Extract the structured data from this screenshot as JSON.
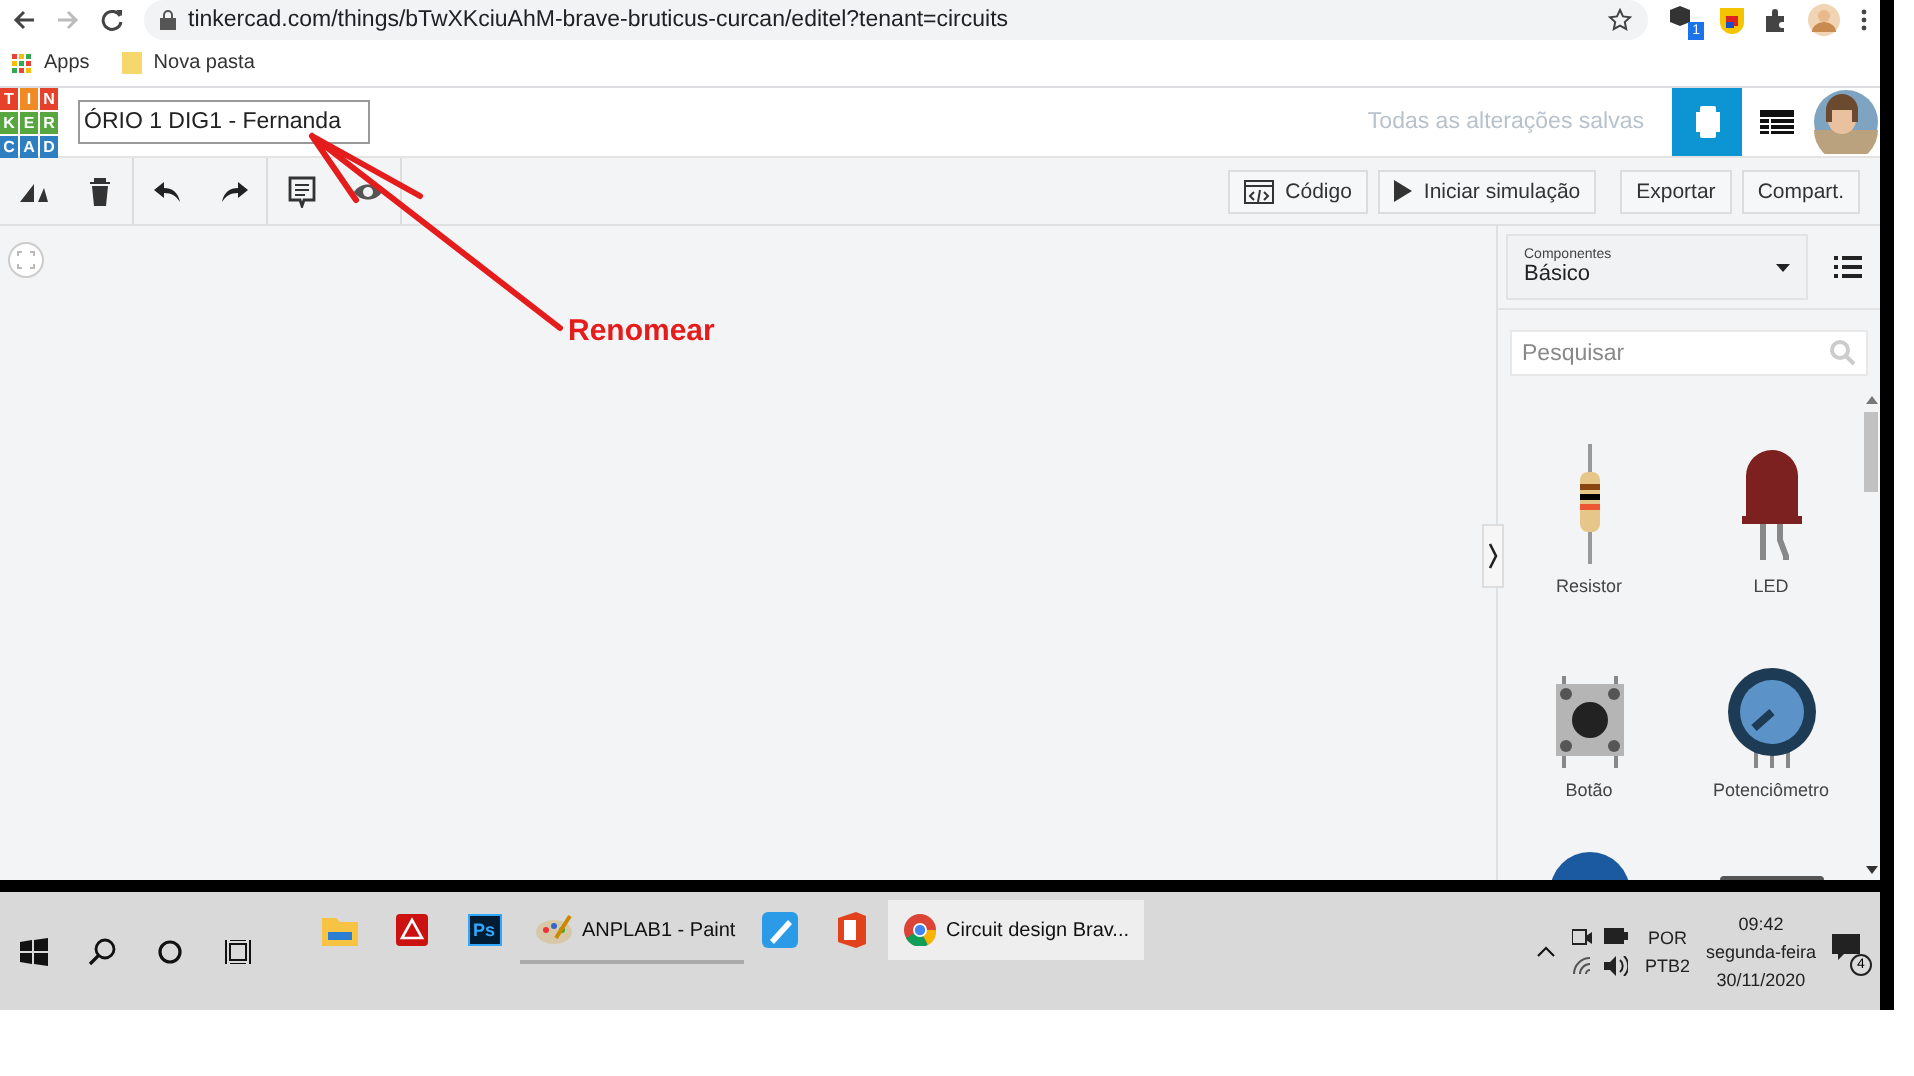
{
  "browser": {
    "url": "tinkercad.com/things/bTwXKciuAhM-brave-bruticus-curcan/editel?tenant=circuits",
    "extension_badge": "1"
  },
  "bookmarks": [
    {
      "label": "Apps",
      "kind": "apps"
    },
    {
      "label": "Nova pasta",
      "kind": "folder"
    }
  ],
  "header": {
    "logo": [
      "T",
      "I",
      "N",
      "K",
      "E",
      "R",
      "C",
      "A",
      "D"
    ],
    "title": "ÓRIO 1 DIG1 - Fernanda",
    "save_status": "Todas as alterações salvas",
    "views": [
      {
        "kind": "circuit",
        "selected": true
      },
      {
        "kind": "table",
        "selected": false
      }
    ]
  },
  "toolbar": {
    "tools": [
      {
        "kind": "rotate"
      },
      {
        "kind": "delete"
      },
      {
        "kind": "undo"
      },
      {
        "kind": "redo"
      },
      {
        "kind": "notes"
      },
      {
        "kind": "eye"
      }
    ],
    "buttons": [
      {
        "label": "Código",
        "kind": "code"
      },
      {
        "label": "Iniciar simulação",
        "kind": "play"
      },
      {
        "label": "Exportar",
        "kind": "plain"
      },
      {
        "label": "Compart.",
        "kind": "plain"
      }
    ]
  },
  "annotation": {
    "label": "Renomear"
  },
  "panel": {
    "dropdown_label": "Componentes",
    "dropdown_value": "Básico",
    "search": {
      "placeholder": "Pesquisar"
    },
    "components": [
      {
        "name": "Resistor",
        "kind": "resistor"
      },
      {
        "name": "LED",
        "kind": "led"
      },
      {
        "name": "Botão",
        "kind": "pushbutton"
      },
      {
        "name": "Potenciômetro",
        "kind": "potentiometer"
      },
      {
        "kind": "dome"
      },
      {
        "kind": "module"
      }
    ]
  },
  "taskbar": {
    "apps": [
      {
        "kind": "explorer"
      },
      {
        "kind": "acrobat"
      },
      {
        "kind": "photoshop",
        "glyph": "Ps"
      },
      {
        "kind": "paint",
        "label": "ANPLAB1 - Paint",
        "selected": false
      },
      {
        "kind": "paint3d"
      },
      {
        "kind": "office"
      },
      {
        "kind": "chrome",
        "label": "Circuit design Brav...",
        "selected": true
      }
    ],
    "language": [
      "POR",
      "PTB2"
    ],
    "time": "09:42",
    "day": "segunda-feira",
    "date": "30/11/2020",
    "notifications": "4"
  }
}
